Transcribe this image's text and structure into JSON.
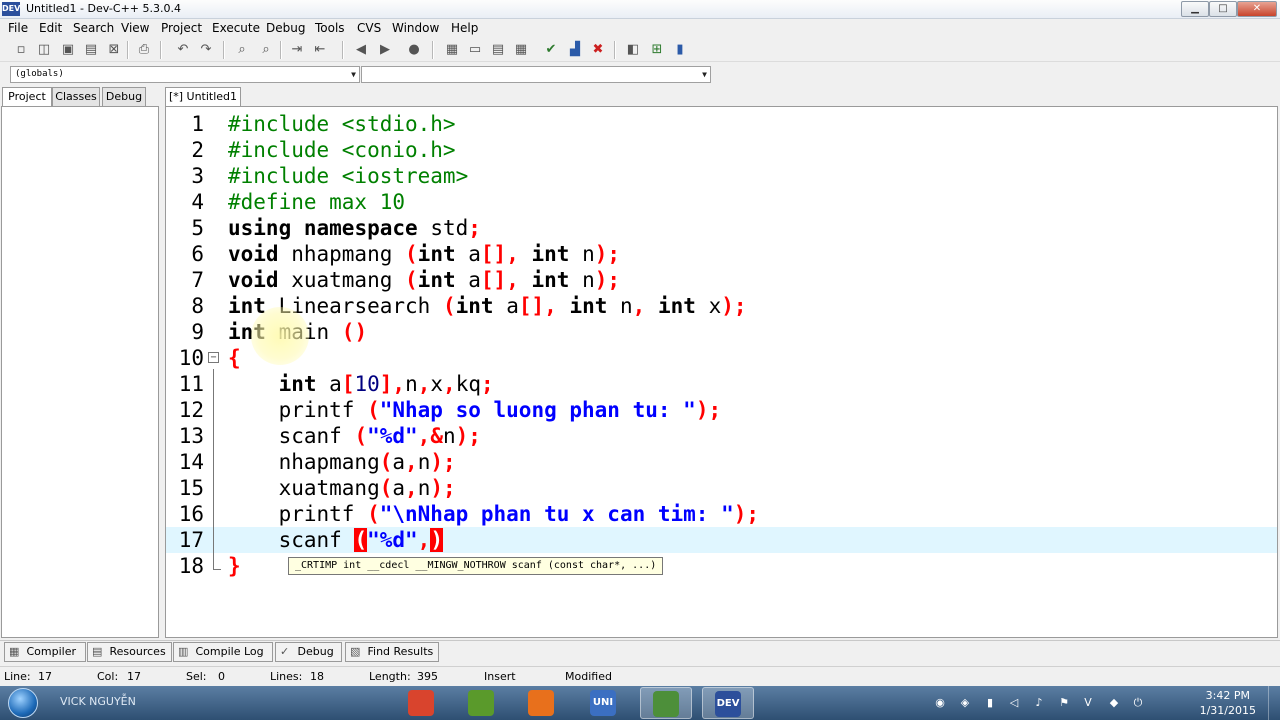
{
  "window": {
    "title": "Untitled1 - Dev-C++ 5.3.0.4",
    "app_icon_text": "DEV",
    "minimize_glyph": "▁",
    "maximize_glyph": "□",
    "close_glyph": "✕"
  },
  "menu": [
    "File",
    "Edit",
    "Search",
    "View",
    "Project",
    "Execute",
    "Debug",
    "Tools",
    "CVS",
    "Window",
    "Help"
  ],
  "toolbar": [
    {
      "icon": "new-file-icon",
      "glyph": "▫"
    },
    {
      "icon": "open-project-icon",
      "glyph": "◫"
    },
    {
      "icon": "save-icon",
      "glyph": "▣"
    },
    {
      "icon": "save-all-icon",
      "glyph": "▤"
    },
    {
      "icon": "close-file-icon",
      "glyph": "⊠"
    },
    {
      "icon": "print-icon",
      "glyph": "⎙"
    },
    {
      "icon": "undo-icon",
      "glyph": "↶"
    },
    {
      "icon": "redo-icon",
      "glyph": "↷"
    },
    {
      "icon": "find-icon",
      "glyph": "⌕"
    },
    {
      "icon": "replace-icon",
      "glyph": "⌕"
    },
    {
      "icon": "indent-icon",
      "glyph": "⇥"
    },
    {
      "icon": "unindent-icon",
      "glyph": "⇤"
    },
    {
      "icon": "back-icon",
      "glyph": "◀"
    },
    {
      "icon": "forward-icon",
      "glyph": "▶"
    },
    {
      "icon": "goto-icon",
      "glyph": "●"
    },
    {
      "icon": "grid-icon",
      "glyph": "▦"
    },
    {
      "icon": "window-icon",
      "glyph": "▭"
    },
    {
      "icon": "class-icon",
      "glyph": "▤"
    },
    {
      "icon": "tiles-icon",
      "glyph": "▦"
    },
    {
      "icon": "compile-icon",
      "glyph": "✔"
    },
    {
      "icon": "chart-icon",
      "glyph": "▟"
    },
    {
      "icon": "delete-icon",
      "glyph": "✖"
    },
    {
      "icon": "project-options-icon",
      "glyph": "◧"
    },
    {
      "icon": "add-to-project-icon",
      "glyph": "⊞"
    },
    {
      "icon": "remove-from-project-icon",
      "glyph": "▮"
    }
  ],
  "combos": {
    "scope": "(globals)",
    "members": ""
  },
  "left_tabs": [
    "Project",
    "Classes",
    "Debug"
  ],
  "editor_tab": "[*] Untitled1",
  "code_lines": [
    {
      "n": "1",
      "tokens": [
        {
          "t": "#include <stdio.h>",
          "c": "pp"
        }
      ]
    },
    {
      "n": "2",
      "tokens": [
        {
          "t": "#include <conio.h>",
          "c": "pp"
        }
      ]
    },
    {
      "n": "3",
      "tokens": [
        {
          "t": "#include <iostream>",
          "c": "pp"
        }
      ]
    },
    {
      "n": "4",
      "tokens": [
        {
          "t": "#define max 10",
          "c": "pp"
        }
      ]
    },
    {
      "n": "5",
      "tokens": [
        {
          "t": "using",
          "c": "kw"
        },
        {
          "t": " ",
          "c": "plain"
        },
        {
          "t": "namespace",
          "c": "kw"
        },
        {
          "t": " std",
          "c": "plain"
        },
        {
          "t": ";",
          "c": "sym"
        }
      ]
    },
    {
      "n": "6",
      "tokens": [
        {
          "t": "void",
          "c": "kw"
        },
        {
          "t": " nhapmang ",
          "c": "plain"
        },
        {
          "t": "(",
          "c": "sym"
        },
        {
          "t": "int",
          "c": "kw"
        },
        {
          "t": " a",
          "c": "plain"
        },
        {
          "t": "[],",
          "c": "sym"
        },
        {
          "t": " ",
          "c": "plain"
        },
        {
          "t": "int",
          "c": "kw"
        },
        {
          "t": " n",
          "c": "plain"
        },
        {
          "t": ");",
          "c": "sym"
        }
      ]
    },
    {
      "n": "7",
      "tokens": [
        {
          "t": "void",
          "c": "kw"
        },
        {
          "t": " xuatmang ",
          "c": "plain"
        },
        {
          "t": "(",
          "c": "sym"
        },
        {
          "t": "int",
          "c": "kw"
        },
        {
          "t": " a",
          "c": "plain"
        },
        {
          "t": "[],",
          "c": "sym"
        },
        {
          "t": " ",
          "c": "plain"
        },
        {
          "t": "int",
          "c": "kw"
        },
        {
          "t": " n",
          "c": "plain"
        },
        {
          "t": ");",
          "c": "sym"
        }
      ]
    },
    {
      "n": "8",
      "tokens": [
        {
          "t": "int",
          "c": "kw"
        },
        {
          "t": " Linearsearch ",
          "c": "plain"
        },
        {
          "t": "(",
          "c": "sym"
        },
        {
          "t": "int",
          "c": "kw"
        },
        {
          "t": " a",
          "c": "plain"
        },
        {
          "t": "[],",
          "c": "sym"
        },
        {
          "t": " ",
          "c": "plain"
        },
        {
          "t": "int",
          "c": "kw"
        },
        {
          "t": " n",
          "c": "plain"
        },
        {
          "t": ",",
          "c": "sym"
        },
        {
          "t": " ",
          "c": "plain"
        },
        {
          "t": "int",
          "c": "kw"
        },
        {
          "t": " x",
          "c": "plain"
        },
        {
          "t": ");",
          "c": "sym"
        }
      ]
    },
    {
      "n": "9",
      "tokens": [
        {
          "t": "int",
          "c": "kw"
        },
        {
          "t": " main ",
          "c": "plain"
        },
        {
          "t": "()",
          "c": "sym"
        }
      ]
    },
    {
      "n": "10",
      "tokens": [
        {
          "t": "{",
          "c": "brace"
        }
      ]
    },
    {
      "n": "11",
      "tokens": [
        {
          "t": "    ",
          "c": "plain"
        },
        {
          "t": "int",
          "c": "kw"
        },
        {
          "t": " a",
          "c": "plain"
        },
        {
          "t": "[",
          "c": "sym"
        },
        {
          "t": "10",
          "c": "num"
        },
        {
          "t": "],",
          "c": "sym"
        },
        {
          "t": "n",
          "c": "plain"
        },
        {
          "t": ",",
          "c": "sym"
        },
        {
          "t": "x",
          "c": "plain"
        },
        {
          "t": ",",
          "c": "sym"
        },
        {
          "t": "kq",
          "c": "plain"
        },
        {
          "t": ";",
          "c": "sym"
        }
      ]
    },
    {
      "n": "12",
      "tokens": [
        {
          "t": "    printf ",
          "c": "plain"
        },
        {
          "t": "(",
          "c": "sym"
        },
        {
          "t": "\"Nhap so luong phan tu: \"",
          "c": "str"
        },
        {
          "t": ");",
          "c": "sym"
        }
      ]
    },
    {
      "n": "13",
      "tokens": [
        {
          "t": "    scanf ",
          "c": "plain"
        },
        {
          "t": "(",
          "c": "sym"
        },
        {
          "t": "\"%d\"",
          "c": "str"
        },
        {
          "t": ",&",
          "c": "sym"
        },
        {
          "t": "n",
          "c": "plain"
        },
        {
          "t": ");",
          "c": "sym"
        }
      ]
    },
    {
      "n": "14",
      "tokens": [
        {
          "t": "    nhapmang",
          "c": "plain"
        },
        {
          "t": "(",
          "c": "sym"
        },
        {
          "t": "a",
          "c": "plain"
        },
        {
          "t": ",",
          "c": "sym"
        },
        {
          "t": "n",
          "c": "plain"
        },
        {
          "t": ");",
          "c": "sym"
        }
      ]
    },
    {
      "n": "15",
      "tokens": [
        {
          "t": "    xuatmang",
          "c": "plain"
        },
        {
          "t": "(",
          "c": "sym"
        },
        {
          "t": "a",
          "c": "plain"
        },
        {
          "t": ",",
          "c": "sym"
        },
        {
          "t": "n",
          "c": "plain"
        },
        {
          "t": ");",
          "c": "sym"
        }
      ]
    },
    {
      "n": "16",
      "tokens": [
        {
          "t": "    printf ",
          "c": "plain"
        },
        {
          "t": "(",
          "c": "sym"
        },
        {
          "t": "\"\\nNhap phan tu x can tim: \"",
          "c": "str"
        },
        {
          "t": ");",
          "c": "sym"
        }
      ]
    },
    {
      "n": "17",
      "tokens": [
        {
          "t": "    scanf ",
          "c": "plain"
        },
        {
          "t": "(",
          "c": "hl-brace"
        },
        {
          "t": "\"%d\"",
          "c": "str"
        },
        {
          "t": ",",
          "c": "sym"
        },
        {
          "t": ")",
          "c": "hl-brace"
        }
      ]
    },
    {
      "n": "18",
      "tokens": [
        {
          "t": "}",
          "c": "brace"
        }
      ]
    }
  ],
  "current_line": "17",
  "tooltip": "_CRTIMP int __cdecl __MINGW_NOTHROW scanf (const char*, ...)",
  "bottom_tabs": [
    {
      "label": "Compiler",
      "icon": "compiler-icon",
      "glyph": "▦"
    },
    {
      "label": "Resources",
      "icon": "resources-icon",
      "glyph": "▤"
    },
    {
      "label": "Compile Log",
      "icon": "compile-log-icon",
      "glyph": "▥"
    },
    {
      "label": "Debug",
      "icon": "debug-icon",
      "glyph": "✓"
    },
    {
      "label": "Find Results",
      "icon": "find-results-icon",
      "glyph": "▧"
    }
  ],
  "status": {
    "line_label": "Line:",
    "line": "17",
    "col_label": "Col:",
    "col": "17",
    "sel_label": "Sel:",
    "sel": "0",
    "lines_label": "Lines:",
    "lines": "18",
    "length_label": "Length:",
    "length": "395",
    "mode": "Insert",
    "modified": "Modified"
  },
  "taskbar": {
    "user": "VICK NGUYỄN",
    "apps": [
      {
        "icon": "chrome-icon",
        "color": "#d9442d",
        "text": "",
        "active": false
      },
      {
        "icon": "green-app-icon",
        "color": "#5a9a2b",
        "text": "",
        "active": false
      },
      {
        "icon": "firefox-icon",
        "color": "#e8701c",
        "text": "",
        "active": false
      },
      {
        "icon": "unikey-icon",
        "color": "#3b6fc2",
        "text": "UNI",
        "active": false
      },
      {
        "icon": "notepad-icon",
        "color": "#4d8f3a",
        "text": "",
        "active": true
      },
      {
        "icon": "devcpp-icon",
        "color": "#2c4f9b",
        "text": "DEV",
        "active": true
      }
    ],
    "tray": [
      {
        "icon": "skype-icon",
        "glyph": "◉"
      },
      {
        "icon": "network-icon",
        "glyph": "◈"
      },
      {
        "icon": "battery-icon",
        "glyph": "▮"
      },
      {
        "icon": "speaker-muted-icon",
        "glyph": "◁"
      },
      {
        "icon": "volume-icon",
        "glyph": "♪"
      },
      {
        "icon": "flag-icon",
        "glyph": "⚑"
      },
      {
        "icon": "v-icon",
        "glyph": "V"
      },
      {
        "icon": "shield-icon",
        "glyph": "◆"
      },
      {
        "icon": "power-icon",
        "glyph": "⏻"
      }
    ],
    "time": "3:42 PM",
    "date": "1/31/2015"
  }
}
